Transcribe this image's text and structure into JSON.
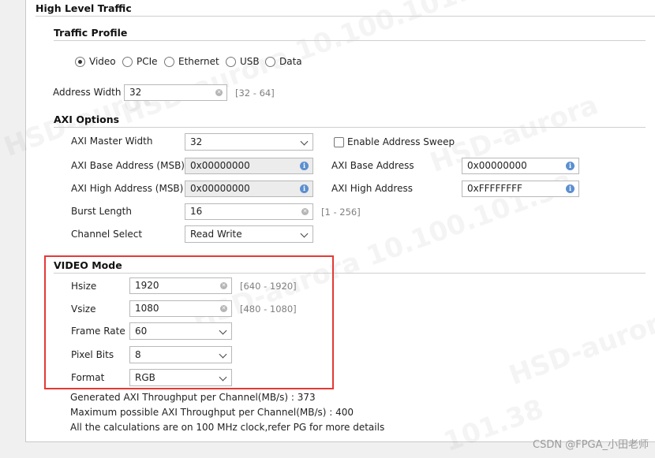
{
  "sections": {
    "high_level_traffic": "High Level Traffic",
    "traffic_profile": "Traffic Profile",
    "axi_options": "AXI Options",
    "video_mode": "VIDEO Mode"
  },
  "traffic_profile": {
    "options": [
      "Video",
      "PCIe",
      "Ethernet",
      "USB",
      "Data"
    ],
    "selected": "Video"
  },
  "address_width": {
    "label": "Address Width",
    "value": "32",
    "range": "[32 - 64]"
  },
  "axi": {
    "master_width": {
      "label": "AXI Master Width",
      "value": "32"
    },
    "address_sweep": {
      "label": "Enable Address Sweep",
      "checked": false
    },
    "base_msb": {
      "label": "AXI Base Address (MSB)",
      "value": "0x00000000"
    },
    "base": {
      "label": "AXI Base Address",
      "value": "0x00000000"
    },
    "high_msb": {
      "label": "AXI High Address (MSB)",
      "value": "0x00000000"
    },
    "high": {
      "label": "AXI High Address",
      "value": "0xFFFFFFFF"
    },
    "burst_length": {
      "label": "Burst Length",
      "value": "16",
      "range": "[1 - 256]"
    },
    "channel_select": {
      "label": "Channel Select",
      "value": "Read Write"
    }
  },
  "video": {
    "hsize": {
      "label": "Hsize",
      "value": "1920",
      "range": "[640 - 1920]"
    },
    "vsize": {
      "label": "Vsize",
      "value": "1080",
      "range": "[480 - 1080]"
    },
    "frame_rate": {
      "label": "Frame Rate",
      "value": "60"
    },
    "pixel_bits": {
      "label": "Pixel Bits",
      "value": "8"
    },
    "format": {
      "label": "Format",
      "value": "RGB"
    }
  },
  "info": {
    "generated": "Generated AXI Throughput per Channel(MB/s) : 373",
    "maximum": "Maximum possible AXI Throughput per Channel(MB/s) : 400",
    "note": "All the calculations are on 100 MHz clock,refer PG for more details"
  },
  "credit": "CSDN @FPGA_小田老师",
  "watermark_text": [
    "HSD-aurora 10.100.101.38",
    "HSD-aurora 10.100.101.38",
    "HSD-aurora",
    "101.38",
    "HSD-aurora",
    "HSD-aurora"
  ],
  "colors": {
    "highlight": "#e53935",
    "info_icon": "#5b8fd0"
  }
}
